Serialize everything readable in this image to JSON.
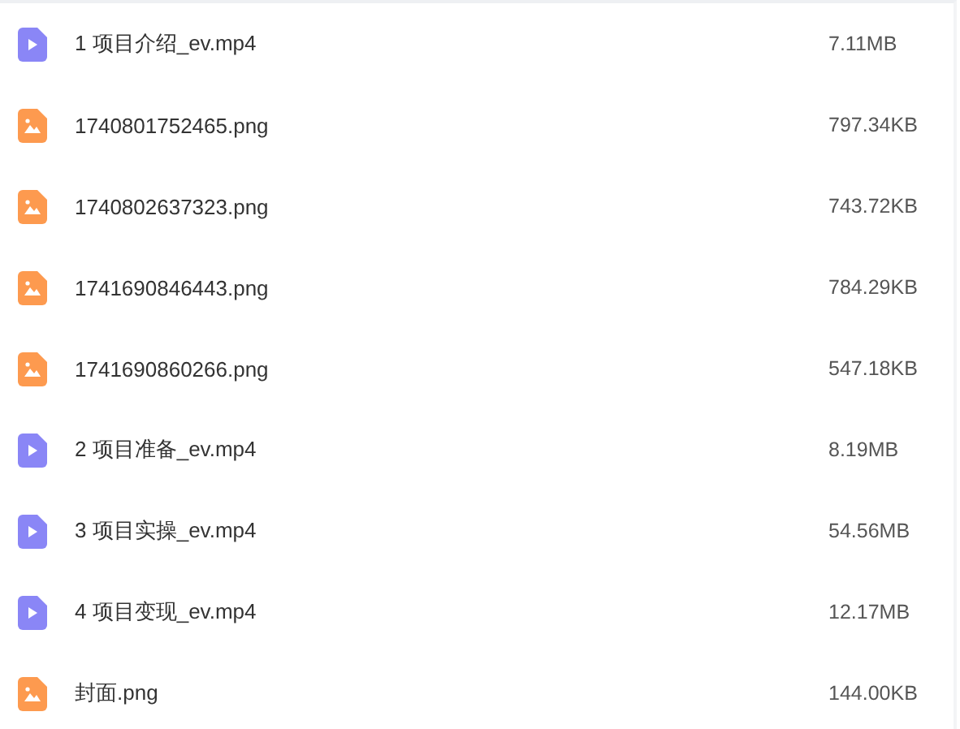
{
  "files": [
    {
      "kind": "video",
      "name": "1 项目介绍_ev.mp4",
      "size": "7.11MB"
    },
    {
      "kind": "image",
      "name": "1740801752465.png",
      "size": "797.34KB"
    },
    {
      "kind": "image",
      "name": "1740802637323.png",
      "size": "743.72KB"
    },
    {
      "kind": "image",
      "name": "1741690846443.png",
      "size": "784.29KB"
    },
    {
      "kind": "image",
      "name": "1741690860266.png",
      "size": "547.18KB"
    },
    {
      "kind": "video",
      "name": "2 项目准备_ev.mp4",
      "size": "8.19MB"
    },
    {
      "kind": "video",
      "name": "3 项目实操_ev.mp4",
      "size": "54.56MB"
    },
    {
      "kind": "video",
      "name": "4 项目变现_ev.mp4",
      "size": "12.17MB"
    },
    {
      "kind": "image",
      "name": "封面.png",
      "size": "144.00KB"
    }
  ]
}
